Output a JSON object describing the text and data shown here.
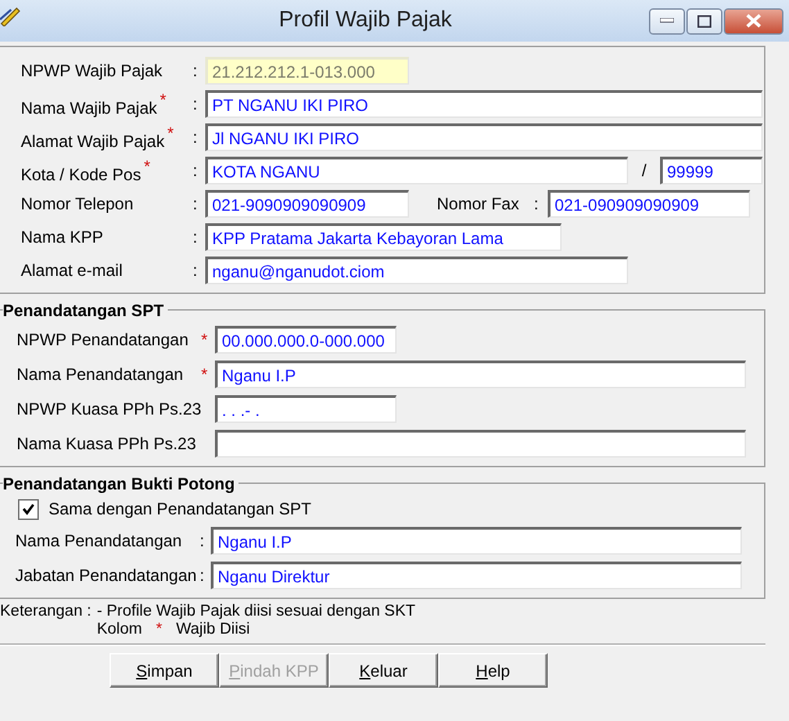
{
  "window": {
    "title": "Profil Wajib Pajak"
  },
  "taxpayer": {
    "rows": [
      {
        "label": "NPWP Wajib Pajak",
        "mark": "",
        "separator": ":",
        "value": "21.212.212.1-013.000",
        "readonly": true
      },
      {
        "label": "Nama Wajib Pajak",
        "mark": "*",
        "separator": ":",
        "value": "PT NGANU IKI PIRO",
        "readonly": false
      },
      {
        "label": "Alamat Wajib Pajak",
        "mark": "*",
        "separator": ":",
        "value": "Jl NGANU IKI PIRO",
        "readonly": false
      },
      {
        "label": "Kota / Kode Pos",
        "mark": "*",
        "separator": ":",
        "value": "KOTA NGANU",
        "slash": "/",
        "postcode": "99999",
        "readonly": false
      },
      {
        "label": "Nomor Telepon",
        "mark": "",
        "separator": ":",
        "value": "021-9090909090909",
        "fax_label": "Nomor Fax",
        "fax_separator": ":",
        "fax_value": "021-090909090909",
        "readonly": false
      },
      {
        "label": "Nama KPP",
        "mark": "",
        "separator": ":",
        "value": "KPP Pratama Jakarta Kebayoran Lama",
        "readonly": false
      },
      {
        "label": "Alamat e-mail",
        "mark": "",
        "separator": ":",
        "value": "nganu@nganudot.ciom",
        "readonly": false
      }
    ]
  },
  "spt_signer": {
    "title": "Penandatangan SPT",
    "rows": [
      {
        "label": "NPWP Penandatangan",
        "required": "*",
        "value": "00.000.000.0-000.000"
      },
      {
        "label": "Nama Penandatangan",
        "required": "*",
        "value": "Nganu I.P"
      },
      {
        "label": "NPWP Kuasa PPh Ps.23",
        "required": "",
        "value": ". . .- ."
      },
      {
        "label": "Nama Kuasa PPh Ps.23",
        "required": "",
        "value": ""
      }
    ]
  },
  "proof_signer": {
    "title": "Penandatangan Bukti Potong",
    "same_as_spt": {
      "label": "Sama dengan Penandatangan SPT",
      "checked": true
    },
    "rows": [
      {
        "label": "Nama Penandatangan",
        "separator": ":",
        "value": "Nganu I.P"
      },
      {
        "label": "Jabatan Penandatangan",
        "separator": ":",
        "value": "Nganu Direktur"
      }
    ]
  },
  "notes": {
    "heading": "Keterangan :",
    "line_1": "- Profile Wajib Pajak diisi sesuai dengan SKT",
    "line_2_start": "Kolom",
    "line_2_mark": "*",
    "line_2_end": "Wajib Diisi"
  },
  "buttons": [
    {
      "label": "Simpan",
      "disabled": false
    },
    {
      "label": "Pindah KPP",
      "disabled": true
    },
    {
      "label": "Keluar",
      "disabled": false
    },
    {
      "label": "Help",
      "disabled": false
    }
  ]
}
